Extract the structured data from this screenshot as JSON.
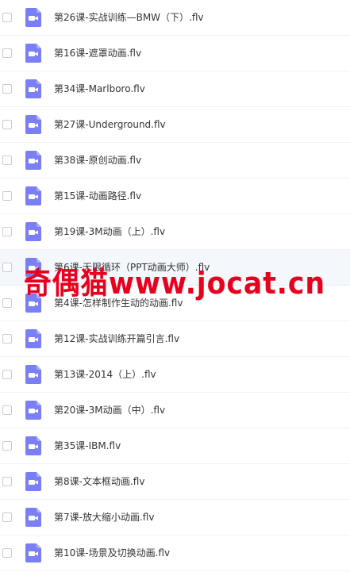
{
  "files": [
    {
      "name": "第26课-实战训练—BMW（下）.flv"
    },
    {
      "name": "第16课-遮罩动画.flv"
    },
    {
      "name": "第34课-Marlboro.flv"
    },
    {
      "name": "第27课-Underground.flv"
    },
    {
      "name": "第38课-原创动画.flv"
    },
    {
      "name": "第15课-动画路径.flv"
    },
    {
      "name": "第19课-3M动画（上）.flv"
    },
    {
      "name": "第6课-无限循环（PPT动画大师）.flv",
      "hovered": true
    },
    {
      "name": "第4课-怎样制作生动的动画.flv"
    },
    {
      "name": "第12课-实战训练开篇引言.flv"
    },
    {
      "name": "第13课-2014（上）.flv"
    },
    {
      "name": "第20课-3M动画（中）.flv"
    },
    {
      "name": "第35课-IBM.flv"
    },
    {
      "name": "第8课-文本框动画.flv"
    },
    {
      "name": "第7课-放大缩小动画.flv"
    },
    {
      "name": "第10课-场景及切换动画.flv"
    }
  ],
  "watermark": {
    "text": "奇偶猫www.jocat.cn",
    "color": "#e8001c"
  },
  "colors": {
    "video_icon": "#7b7ff5"
  }
}
